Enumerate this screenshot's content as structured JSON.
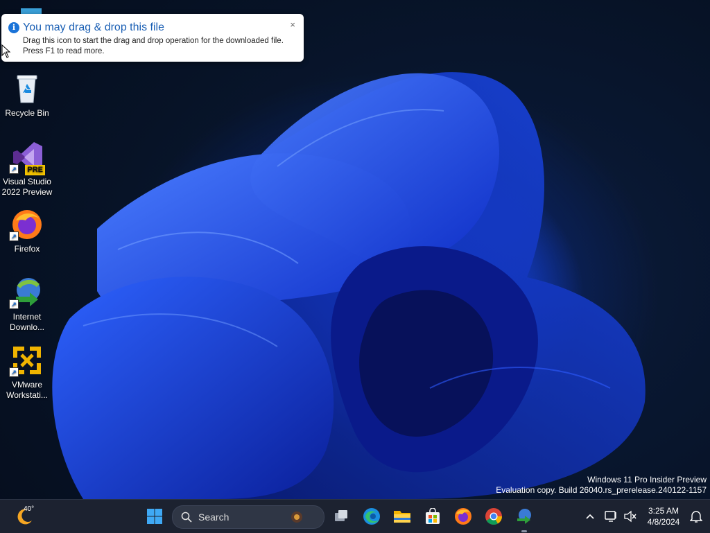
{
  "notification": {
    "title": "You may drag & drop this file",
    "line1": "Drag this icon to start the drag and drop operation for the downloaded file.",
    "line2": "Press F1 to read more.",
    "close": "×"
  },
  "desktop_icons": {
    "recycle": "Recycle Bin",
    "vs_line1": "Visual Studio",
    "vs_line2": "2022 Preview",
    "vs_badge": "PRE",
    "firefox": "Firefox",
    "idm_line1": "Internet",
    "idm_line2": "Downlo...",
    "vmware_line1": "VMware",
    "vmware_line2": "Workstati..."
  },
  "watermark": {
    "line1": "Windows 11 Pro Insider Preview",
    "line2": "Evaluation copy. Build 26040.rs_prerelease.240122-1157"
  },
  "taskbar": {
    "weather_temp": "40°",
    "search_placeholder": "Search",
    "time": "3:25 AM",
    "date": "4/8/2024"
  },
  "colors": {
    "accent": "#1a73d8",
    "taskbar_bg": "#1c2230"
  }
}
